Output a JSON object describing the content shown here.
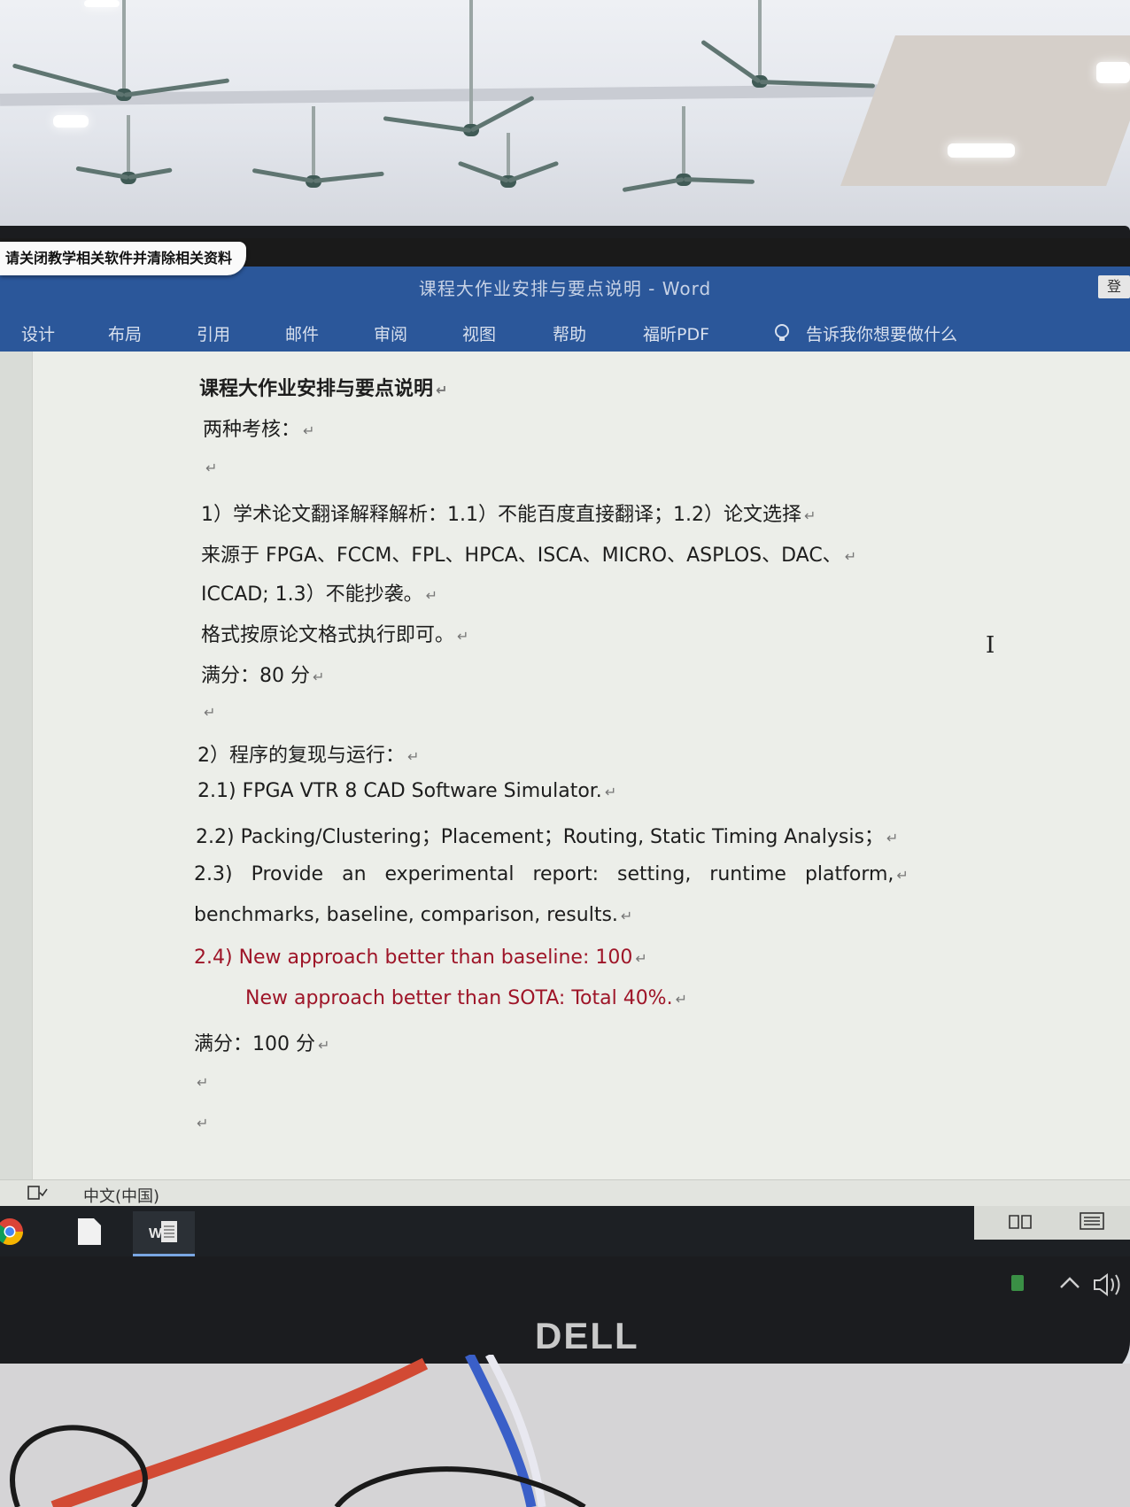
{
  "notification": {
    "text": "请关闭教学相关软件并清除相关资料"
  },
  "window": {
    "title": "课程大作业安排与要点说明  -  Word",
    "corner_button": "登"
  },
  "ribbon": {
    "tabs": [
      "设计",
      "布局",
      "引用",
      "邮件",
      "审阅",
      "视图",
      "帮助",
      "福昕PDF"
    ],
    "tell_me": "告诉我你想要做什么"
  },
  "document": {
    "lines": [
      {
        "text": "课程大作业安排与要点说明",
        "red": false
      },
      {
        "text": "两种考核：",
        "red": false
      },
      {
        "text": "",
        "red": false
      },
      {
        "text": "1）学术论文翻译解释解析：1.1）不能百度直接翻译；1.2）论文选择",
        "red": false
      },
      {
        "text": "来源于 FPGA、FCCM、FPL、HPCA、ISCA、MICRO、ASPLOS、DAC、",
        "red": false
      },
      {
        "text": "ICCAD; 1.3）不能抄袭。",
        "red": false
      },
      {
        "text": "格式按原论文格式执行即可。",
        "red": false
      },
      {
        "text": "满分：80 分",
        "red": false
      },
      {
        "text": "",
        "red": false
      },
      {
        "text": "2）程序的复现与运行：",
        "red": false
      },
      {
        "text": "2.1) FPGA VTR 8 CAD Software Simulator.",
        "red": false
      },
      {
        "text": "2.2) Packing/Clustering；Placement；Routing, Static Timing Analysis；",
        "red": false
      },
      {
        "text": "2.3) Provide an experimental report: setting, runtime platform,",
        "red": false
      },
      {
        "text": "benchmarks, baseline, comparison, results.",
        "red": false
      },
      {
        "text": "2.4) New approach better than baseline: 100",
        "red": true
      },
      {
        "text": "New approach better than SOTA: Total 40%.",
        "red": true
      },
      {
        "text": "满分：100 分",
        "red": false
      },
      {
        "text": "",
        "red": false
      },
      {
        "text": "",
        "red": false
      }
    ],
    "paragraph_mark": "↵"
  },
  "statusbar": {
    "language": "中文(中国)"
  },
  "taskbar": {
    "word_icon_text": "W"
  },
  "monitor": {
    "brand": "DELL"
  },
  "colors": {
    "word_blue": "#2b579a",
    "red_text": "#9e1528"
  }
}
